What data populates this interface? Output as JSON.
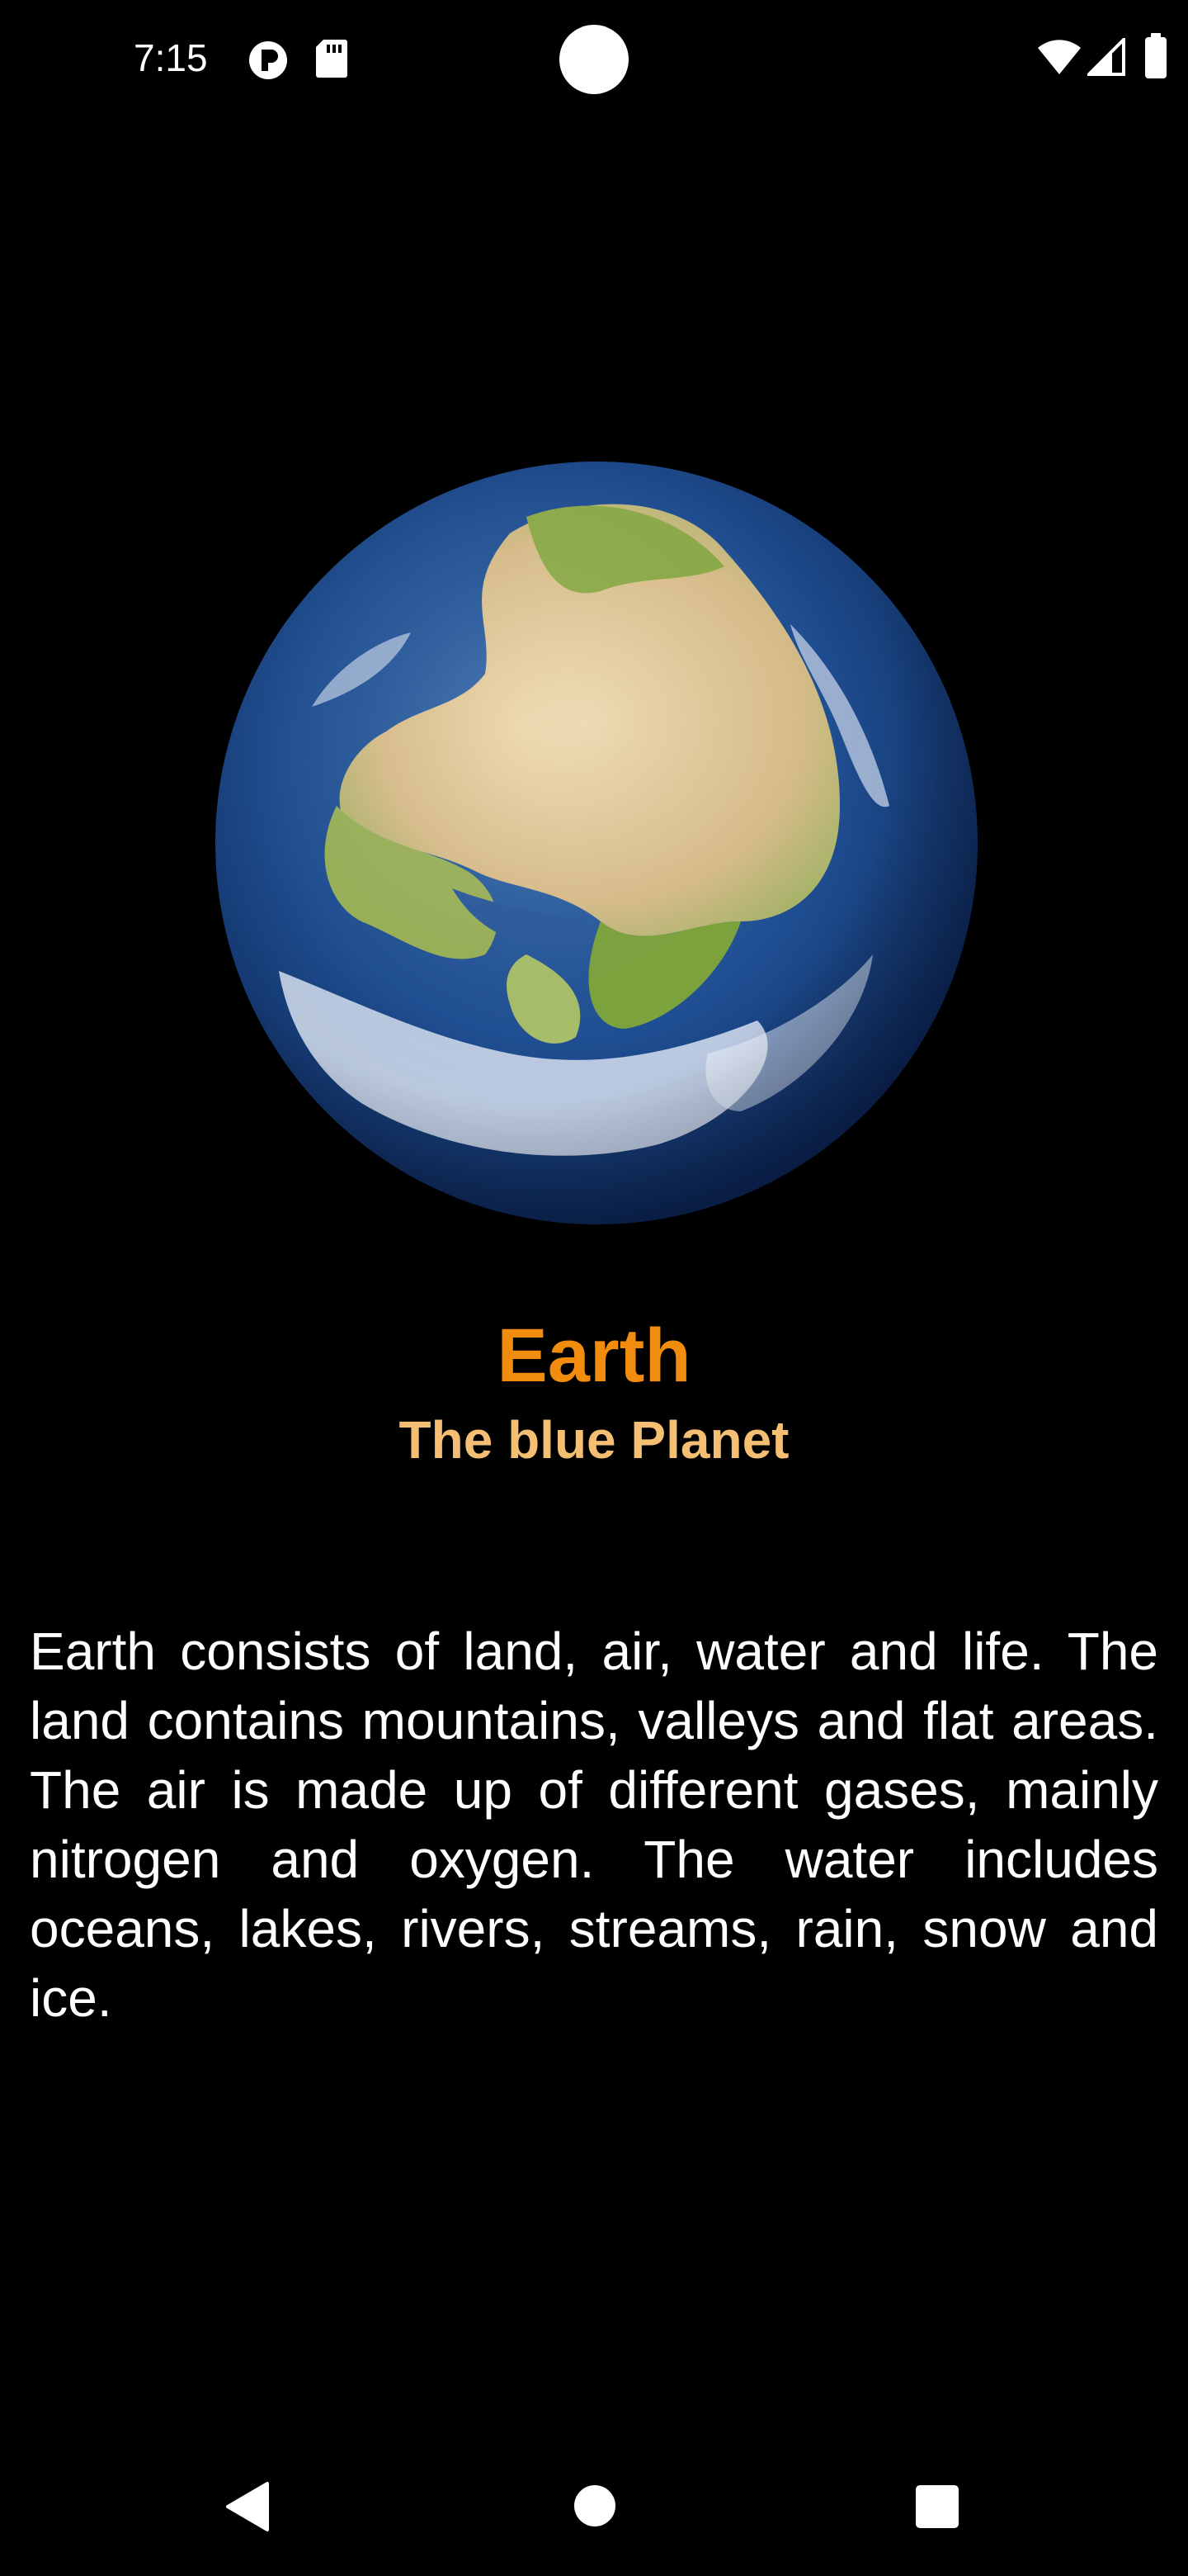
{
  "status_bar": {
    "time": "7:15",
    "icons": [
      "app-notification-icon",
      "sd-card-icon",
      "wifi-icon",
      "cellular-signal-icon",
      "battery-icon"
    ]
  },
  "planet": {
    "image_icon": "earth-globe-image",
    "name": "Earth",
    "tagline": "The blue Planet",
    "description": "Earth consists of land, air, water and life. The land contains mountains, valleys and flat areas. The air is made up of different gases, mainly nitrogen and oxygen. The water includes oceans, lakes, rivers, streams, rain, snow and ice."
  },
  "nav_bar": {
    "buttons": [
      "back-icon",
      "home-icon",
      "recents-icon"
    ]
  },
  "colors": {
    "background": "#000000",
    "title": "#f28c0f",
    "subtitle": "#f5bf73",
    "body_text": "#ffffff"
  }
}
